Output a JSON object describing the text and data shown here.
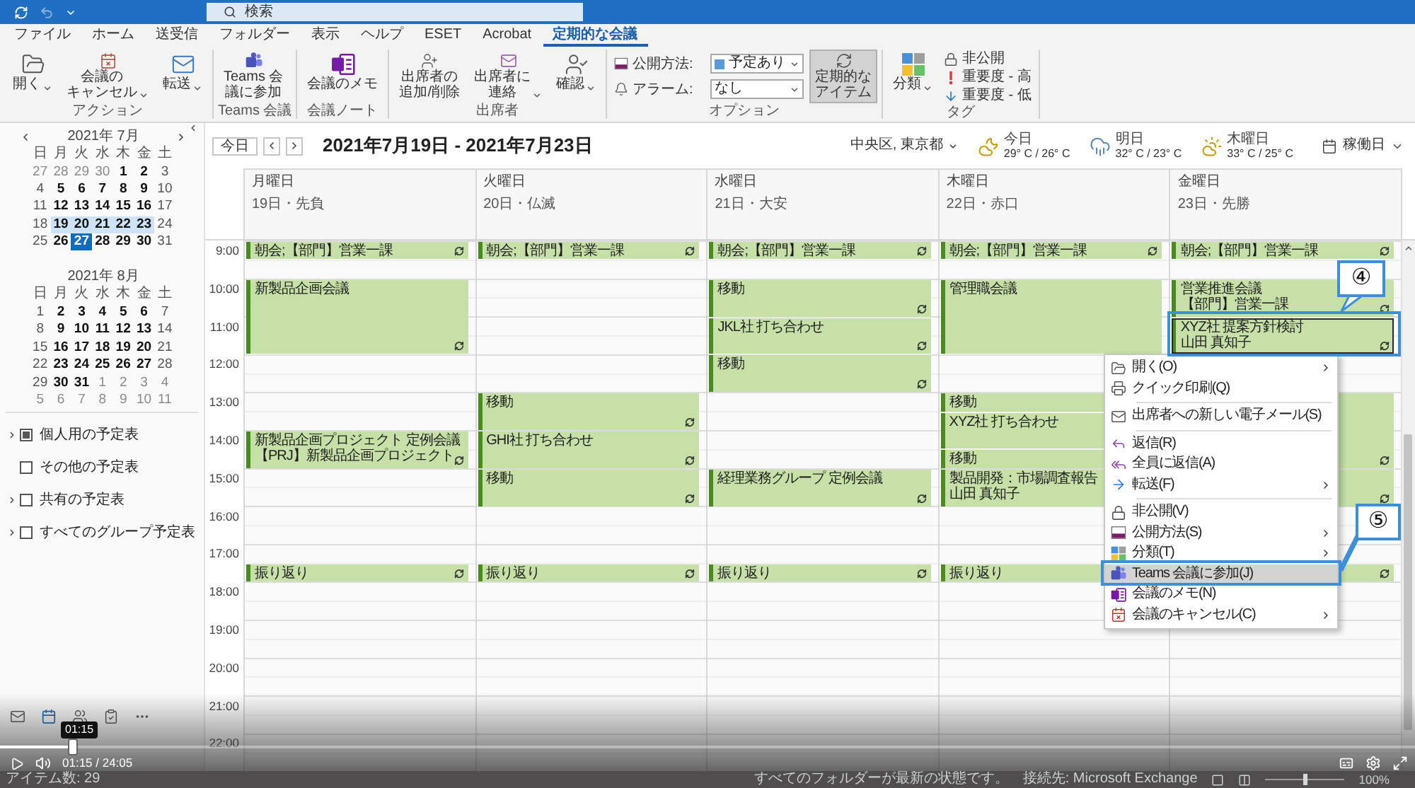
{
  "title_bar": {
    "search": {
      "placeholder": "検索"
    }
  },
  "menu_tabs": [
    {
      "label": "ファイル",
      "selected": false
    },
    {
      "label": "ホーム",
      "selected": false
    },
    {
      "label": "送受信",
      "selected": false
    },
    {
      "label": "フォルダー",
      "selected": false
    },
    {
      "label": "表示",
      "selected": false
    },
    {
      "label": "ヘルプ",
      "selected": false
    },
    {
      "label": "ESET",
      "selected": false
    },
    {
      "label": "Acrobat",
      "selected": false
    },
    {
      "label": "定期的な会議",
      "selected": true
    }
  ],
  "ribbon": [
    {
      "label": "アクション",
      "items": [
        {
          "kind": "large",
          "lines": [
            "開く"
          ],
          "menu": true,
          "pressed": false
        },
        {
          "kind": "large",
          "lines": [
            "会議の",
            "キャンセル"
          ],
          "menu": true,
          "pressed": false
        },
        {
          "kind": "large",
          "lines": [
            "転送"
          ],
          "menu": true,
          "pressed": false
        }
      ]
    },
    {
      "label": "Teams 会議",
      "items": [
        {
          "kind": "large",
          "lines": [
            "Teams 会",
            "議に参加"
          ],
          "menu": false,
          "pressed": false
        }
      ]
    },
    {
      "label": "会議ノート",
      "items": [
        {
          "kind": "large",
          "lines": [
            "会議のメモ"
          ],
          "menu": false,
          "pressed": false
        }
      ]
    },
    {
      "label": "出席者",
      "items": [
        {
          "kind": "large",
          "lines": [
            "出席者の",
            "追加/削除"
          ],
          "menu": false,
          "pressed": false
        },
        {
          "kind": "large",
          "lines": [
            "出席者に",
            "連絡"
          ],
          "menu": true,
          "pressed": false
        },
        {
          "kind": "large",
          "lines": [
            "確認"
          ],
          "menu": true,
          "pressed": false
        }
      ]
    },
    {
      "label": "オプション",
      "items": [
        {
          "kind": "field",
          "label": "公開方法:",
          "value": "予定あり",
          "color": "#5b9bd5"
        },
        {
          "kind": "field",
          "label": "アラーム:",
          "value": "なし"
        },
        {
          "kind": "large",
          "lines": [
            "定期的な",
            "アイテム"
          ],
          "menu": false,
          "pressed": true
        }
      ]
    },
    {
      "label": "タグ",
      "items": [
        {
          "kind": "large",
          "lines": [
            "分類"
          ],
          "menu": true,
          "pressed": false
        },
        {
          "kind": "small",
          "label": "非公開"
        },
        {
          "kind": "small",
          "label": "重要度 - 高"
        },
        {
          "kind": "small",
          "label": "重要度 - 低"
        }
      ]
    }
  ],
  "sidebar": {
    "mini_calendars": [
      {
        "title": "2021年 7月",
        "nav": true,
        "weekdays": [
          "日",
          "月",
          "火",
          "水",
          "木",
          "金",
          "土"
        ],
        "weeks": [
          [
            {
              "day": "27",
              "other": true,
              "bold": false,
              "selected": false,
              "today": false
            },
            {
              "day": "28",
              "other": true,
              "bold": false,
              "selected": false,
              "today": false
            },
            {
              "day": "29",
              "other": true,
              "bold": false,
              "selected": false,
              "today": false
            },
            {
              "day": "30",
              "other": true,
              "bold": false,
              "selected": false,
              "today": false
            },
            {
              "day": "1",
              "other": false,
              "bold": true,
              "selected": false,
              "today": false
            },
            {
              "day": "2",
              "other": false,
              "bold": true,
              "selected": false,
              "today": false
            },
            {
              "day": "3",
              "other": false,
              "bold": false,
              "selected": false,
              "today": false
            }
          ],
          [
            {
              "day": "4",
              "other": false,
              "bold": false,
              "selected": false,
              "today": false
            },
            {
              "day": "5",
              "other": false,
              "bold": true,
              "selected": false,
              "today": false
            },
            {
              "day": "6",
              "other": false,
              "bold": true,
              "selected": false,
              "today": false
            },
            {
              "day": "7",
              "other": false,
              "bold": true,
              "selected": false,
              "today": false
            },
            {
              "day": "8",
              "other": false,
              "bold": true,
              "selected": false,
              "today": false
            },
            {
              "day": "9",
              "other": false,
              "bold": true,
              "selected": false,
              "today": false
            },
            {
              "day": "10",
              "other": false,
              "bold": false,
              "selected": false,
              "today": false
            }
          ],
          [
            {
              "day": "11",
              "other": false,
              "bold": false,
              "selected": false,
              "today": false
            },
            {
              "day": "12",
              "other": false,
              "bold": true,
              "selected": false,
              "today": false
            },
            {
              "day": "13",
              "other": false,
              "bold": true,
              "selected": false,
              "today": false
            },
            {
              "day": "14",
              "other": false,
              "bold": true,
              "selected": false,
              "today": false
            },
            {
              "day": "15",
              "other": false,
              "bold": true,
              "selected": false,
              "today": false
            },
            {
              "day": "16",
              "other": false,
              "bold": true,
              "selected": false,
              "today": false
            },
            {
              "day": "17",
              "other": false,
              "bold": false,
              "selected": false,
              "today": false
            }
          ],
          [
            {
              "day": "18",
              "other": false,
              "bold": false,
              "selected": false,
              "today": false
            },
            {
              "day": "19",
              "other": false,
              "bold": true,
              "selected": true,
              "today": false
            },
            {
              "day": "20",
              "other": false,
              "bold": true,
              "selected": true,
              "today": false
            },
            {
              "day": "21",
              "other": false,
              "bold": true,
              "selected": true,
              "today": false
            },
            {
              "day": "22",
              "other": false,
              "bold": true,
              "selected": true,
              "today": false
            },
            {
              "day": "23",
              "other": false,
              "bold": true,
              "selected": true,
              "today": false
            },
            {
              "day": "24",
              "other": false,
              "bold": false,
              "selected": false,
              "today": false
            }
          ],
          [
            {
              "day": "25",
              "other": false,
              "bold": false,
              "selected": false,
              "today": false
            },
            {
              "day": "26",
              "other": false,
              "bold": true,
              "selected": false,
              "today": false
            },
            {
              "day": "27",
              "other": false,
              "bold": true,
              "selected": false,
              "today": true
            },
            {
              "day": "28",
              "other": false,
              "bold": true,
              "selected": false,
              "today": false
            },
            {
              "day": "29",
              "other": false,
              "bold": true,
              "selected": false,
              "today": false
            },
            {
              "day": "30",
              "other": false,
              "bold": true,
              "selected": false,
              "today": false
            },
            {
              "day": "31",
              "other": false,
              "bold": false,
              "selected": false,
              "today": false
            }
          ]
        ]
      },
      {
        "title": "2021年 8月",
        "nav": false,
        "weekdays": [
          "日",
          "月",
          "火",
          "水",
          "木",
          "金",
          "土"
        ],
        "weeks": [
          [
            {
              "day": "1",
              "other": false,
              "bold": false,
              "selected": false,
              "today": false
            },
            {
              "day": "2",
              "other": false,
              "bold": true,
              "selected": false,
              "today": false
            },
            {
              "day": "3",
              "other": false,
              "bold": true,
              "selected": false,
              "today": false
            },
            {
              "day": "4",
              "other": false,
              "bold": true,
              "selected": false,
              "today": false
            },
            {
              "day": "5",
              "other": false,
              "bold": true,
              "selected": false,
              "today": false
            },
            {
              "day": "6",
              "other": false,
              "bold": true,
              "selected": false,
              "today": false
            },
            {
              "day": "7",
              "other": false,
              "bold": false,
              "selected": false,
              "today": false
            }
          ],
          [
            {
              "day": "8",
              "other": false,
              "bold": false,
              "selected": false,
              "today": false
            },
            {
              "day": "9",
              "other": false,
              "bold": true,
              "selected": false,
              "today": false
            },
            {
              "day": "10",
              "other": false,
              "bold": true,
              "selected": false,
              "today": false
            },
            {
              "day": "11",
              "other": false,
              "bold": true,
              "selected": false,
              "today": false
            },
            {
              "day": "12",
              "other": false,
              "bold": true,
              "selected": false,
              "today": false
            },
            {
              "day": "13",
              "other": false,
              "bold": true,
              "selected": false,
              "today": false
            },
            {
              "day": "14",
              "other": false,
              "bold": false,
              "selected": false,
              "today": false
            }
          ],
          [
            {
              "day": "15",
              "other": false,
              "bold": false,
              "selected": false,
              "today": false
            },
            {
              "day": "16",
              "other": false,
              "bold": true,
              "selected": false,
              "today": false
            },
            {
              "day": "17",
              "other": false,
              "bold": true,
              "selected": false,
              "today": false
            },
            {
              "day": "18",
              "other": false,
              "bold": true,
              "selected": false,
              "today": false
            },
            {
              "day": "19",
              "other": false,
              "bold": true,
              "selected": false,
              "today": false
            },
            {
              "day": "20",
              "other": false,
              "bold": true,
              "selected": false,
              "today": false
            },
            {
              "day": "21",
              "other": false,
              "bold": false,
              "selected": false,
              "today": false
            }
          ],
          [
            {
              "day": "22",
              "other": false,
              "bold": false,
              "selected": false,
              "today": false
            },
            {
              "day": "23",
              "other": false,
              "bold": true,
              "selected": false,
              "today": false
            },
            {
              "day": "24",
              "other": false,
              "bold": true,
              "selected": false,
              "today": false
            },
            {
              "day": "25",
              "other": false,
              "bold": true,
              "selected": false,
              "today": false
            },
            {
              "day": "26",
              "other": false,
              "bold": true,
              "selected": false,
              "today": false
            },
            {
              "day": "27",
              "other": false,
              "bold": true,
              "selected": false,
              "today": false
            },
            {
              "day": "28",
              "other": false,
              "bold": false,
              "selected": false,
              "today": false
            }
          ],
          [
            {
              "day": "29",
              "other": false,
              "bold": false,
              "selected": false,
              "today": false
            },
            {
              "day": "30",
              "other": false,
              "bold": true,
              "selected": false,
              "today": false
            },
            {
              "day": "31",
              "other": false,
              "bold": true,
              "selected": false,
              "today": false
            },
            {
              "day": "1",
              "other": true,
              "bold": false,
              "selected": false,
              "today": false
            },
            {
              "day": "2",
              "other": true,
              "bold": false,
              "selected": false,
              "today": false
            },
            {
              "day": "3",
              "other": true,
              "bold": false,
              "selected": false,
              "today": false
            },
            {
              "day": "4",
              "other": true,
              "bold": false,
              "selected": false,
              "today": false
            }
          ],
          [
            {
              "day": "5",
              "other": true,
              "bold": false,
              "selected": false,
              "today": false
            },
            {
              "day": "6",
              "other": true,
              "bold": false,
              "selected": false,
              "today": false
            },
            {
              "day": "7",
              "other": true,
              "bold": false,
              "selected": false,
              "today": false
            },
            {
              "day": "8",
              "other": true,
              "bold": false,
              "selected": false,
              "today": false
            },
            {
              "day": "9",
              "other": true,
              "bold": false,
              "selected": false,
              "today": false
            },
            {
              "day": "10",
              "other": true,
              "bold": false,
              "selected": false,
              "today": false
            },
            {
              "day": "11",
              "other": true,
              "bold": false,
              "selected": false,
              "today": false
            }
          ]
        ]
      }
    ],
    "calendar_groups": [
      {
        "label": "個人用の予定表",
        "expandable": true,
        "checked": true
      },
      {
        "label": "その他の予定表",
        "expandable": false,
        "checked": false
      },
      {
        "label": "共有の予定表",
        "expandable": true,
        "checked": false
      },
      {
        "label": "すべてのグループ予定表",
        "expandable": true,
        "checked": false
      }
    ]
  },
  "nav_bar": [
    {
      "selected": false
    },
    {
      "selected": true
    },
    {
      "selected": false
    },
    {
      "selected": false
    }
  ],
  "toolbar": {
    "today_button": "今日",
    "date_range": "2021年7月19日 - 2021年7月23日",
    "location": "中央区, 東京都",
    "weather": [
      {
        "day": "今日",
        "temperature": "29° C / 26° C"
      },
      {
        "day": "明日",
        "temperature": "32° C / 23° C"
      },
      {
        "day": "木曜日",
        "temperature": "33° C / 25° C"
      }
    ],
    "view": "稼働日"
  },
  "time_labels": [
    "9:00",
    "10:00",
    "11:00",
    "12:00",
    "13:00",
    "14:00",
    "15:00",
    "16:00",
    "17:00",
    "18:00",
    "19:00",
    "20:00",
    "21:00",
    "22:00"
  ],
  "days": [
    {
      "weekday": "月曜日",
      "date": "19日・先負",
      "half_hour_slots": [
        {
          "kind": "event",
          "lines": [
            "朝会;【部門】営業一課"
          ],
          "recurring": true,
          "selected": false
        },
        {
          "kind": "free"
        },
        {
          "kind": "event",
          "lines": [
            "新製品企画会議"
          ],
          "recurring": true,
          "selected": false
        },
        {
          "kind": "continued"
        },
        {
          "kind": "continued"
        },
        {
          "kind": "continued"
        },
        {
          "kind": "free"
        },
        {
          "kind": "free"
        },
        {
          "kind": "free"
        },
        {
          "kind": "free"
        },
        {
          "kind": "event",
          "lines": [
            "新製品企画プロジェクト 定例会議",
            "【PRJ】新製品企画プロジェクト"
          ],
          "recurring": true,
          "selected": false
        },
        {
          "kind": "continued"
        },
        {
          "kind": "free"
        },
        {
          "kind": "free"
        },
        {
          "kind": "free"
        },
        {
          "kind": "free"
        },
        {
          "kind": "free"
        },
        {
          "kind": "event",
          "lines": [
            "振り返り"
          ],
          "recurring": true,
          "selected": false
        }
      ]
    },
    {
      "weekday": "火曜日",
      "date": "20日・仏滅",
      "half_hour_slots": [
        {
          "kind": "event",
          "lines": [
            "朝会;【部門】営業一課"
          ],
          "recurring": true,
          "selected": false
        },
        {
          "kind": "free"
        },
        {
          "kind": "free"
        },
        {
          "kind": "free"
        },
        {
          "kind": "free"
        },
        {
          "kind": "free"
        },
        {
          "kind": "free"
        },
        {
          "kind": "free"
        },
        {
          "kind": "event",
          "lines": [
            "移動"
          ],
          "recurring": true,
          "selected": false
        },
        {
          "kind": "continued"
        },
        {
          "kind": "event",
          "lines": [
            "GHI社 打ち合わせ"
          ],
          "recurring": true,
          "selected": false
        },
        {
          "kind": "continued"
        },
        {
          "kind": "event",
          "lines": [
            "移動"
          ],
          "recurring": true,
          "selected": false
        },
        {
          "kind": "continued"
        },
        {
          "kind": "free"
        },
        {
          "kind": "free"
        },
        {
          "kind": "free"
        },
        {
          "kind": "event",
          "lines": [
            "振り返り"
          ],
          "recurring": true,
          "selected": false
        }
      ]
    },
    {
      "weekday": "水曜日",
      "date": "21日・大安",
      "half_hour_slots": [
        {
          "kind": "event",
          "lines": [
            "朝会;【部門】営業一課"
          ],
          "recurring": true,
          "selected": false
        },
        {
          "kind": "free"
        },
        {
          "kind": "event",
          "lines": [
            "移動"
          ],
          "recurring": true,
          "selected": false
        },
        {
          "kind": "continued"
        },
        {
          "kind": "event",
          "lines": [
            "JKL社 打ち合わせ"
          ],
          "recurring": true,
          "selected": false
        },
        {
          "kind": "continued"
        },
        {
          "kind": "event",
          "lines": [
            "移動"
          ],
          "recurring": true,
          "selected": false
        },
        {
          "kind": "continued"
        },
        {
          "kind": "free"
        },
        {
          "kind": "free"
        },
        {
          "kind": "free"
        },
        {
          "kind": "free"
        },
        {
          "kind": "event",
          "lines": [
            "経理業務グループ 定例会議"
          ],
          "recurring": true,
          "selected": false
        },
        {
          "kind": "continued"
        },
        {
          "kind": "free"
        },
        {
          "kind": "free"
        },
        {
          "kind": "free"
        },
        {
          "kind": "event",
          "lines": [
            "振り返り"
          ],
          "recurring": true,
          "selected": false
        }
      ]
    },
    {
      "weekday": "木曜日",
      "date": "22日・赤口",
      "half_hour_slots": [
        {
          "kind": "event",
          "lines": [
            "朝会;【部門】営業一課"
          ],
          "recurring": true,
          "selected": false
        },
        {
          "kind": "free"
        },
        {
          "kind": "event",
          "lines": [
            "管理職会議"
          ],
          "recurring": false,
          "selected": false
        },
        {
          "kind": "continued"
        },
        {
          "kind": "continued"
        },
        {
          "kind": "continued"
        },
        {
          "kind": "free"
        },
        {
          "kind": "free"
        },
        {
          "kind": "event",
          "lines": [
            "移動"
          ],
          "selected": false
        },
        {
          "kind": "event",
          "lines": [
            "XYZ社 打ち合わせ"
          ],
          "selected": false
        },
        {
          "kind": "continued"
        },
        {
          "kind": "event",
          "lines": [
            "移動"
          ],
          "selected": false
        },
        {
          "kind": "event",
          "lines": [
            "製品開発：市場調査報告",
            "山田 真知子"
          ],
          "selected": false
        },
        {
          "kind": "continued"
        },
        {
          "kind": "free"
        },
        {
          "kind": "free"
        },
        {
          "kind": "free"
        },
        {
          "kind": "event",
          "lines": [
            "振り返り"
          ],
          "selected": false
        }
      ]
    },
    {
      "weekday": "金曜日",
      "date": "23日・先勝",
      "half_hour_slots": [
        {
          "kind": "event",
          "lines": [
            "朝会;【部門】営業一課"
          ],
          "recurring": true,
          "selected": false
        },
        {
          "kind": "free"
        },
        {
          "kind": "event",
          "lines": [
            "営業推進会議",
            "【部門】営業一課"
          ],
          "recurring": true,
          "selected": false
        },
        {
          "kind": "continued"
        },
        {
          "kind": "event",
          "lines": [
            "XYZ社 提案方針検討",
            "山田 真知子"
          ],
          "recurring": true,
          "selected": true
        },
        {
          "kind": "continued"
        },
        {
          "kind": "free"
        },
        {
          "kind": "free"
        },
        {
          "kind": "event",
          "recurring": true,
          "selected": false
        },
        {
          "kind": "continued"
        },
        {
          "kind": "continued"
        },
        {
          "kind": "continued"
        },
        {
          "kind": "event",
          "recurring": true,
          "selected": false
        },
        {
          "kind": "continued"
        },
        {
          "kind": "free"
        },
        {
          "kind": "free"
        },
        {
          "kind": "free"
        },
        {
          "kind": "event",
          "recurring": true,
          "selected": false
        }
      ]
    }
  ],
  "context_menu": [
    {
      "label": "開く(O)",
      "submenu": true,
      "separator_before": false,
      "selected": false
    },
    {
      "label": "クイック印刷(Q)",
      "submenu": false,
      "separator_before": false,
      "selected": false
    },
    {
      "label": "出席者への新しい電子メール(S)",
      "submenu": false,
      "separator_before": true,
      "selected": false
    },
    {
      "label": "返信(R)",
      "submenu": false,
      "separator_before": true,
      "selected": false
    },
    {
      "label": "全員に返信(A)",
      "submenu": false,
      "separator_before": false,
      "selected": false
    },
    {
      "label": "転送(F)",
      "submenu": true,
      "separator_before": false,
      "selected": false
    },
    {
      "label": "非公開(V)",
      "submenu": false,
      "separator_before": true,
      "selected": false
    },
    {
      "label": "公開方法(S)",
      "submenu": true,
      "separator_before": false,
      "selected": false
    },
    {
      "label": "分類(T)",
      "submenu": true,
      "separator_before": false,
      "selected": false
    },
    {
      "label": "Teams 会議に参加(J)",
      "submenu": false,
      "separator_before": false,
      "selected": true
    },
    {
      "label": "会議のメモ(N)",
      "submenu": false,
      "separator_before": false,
      "selected": false
    },
    {
      "label": "会議のキャンセル(C)",
      "submenu": true,
      "separator_before": false,
      "selected": false
    }
  ],
  "callouts": [
    {
      "label": "④"
    },
    {
      "label": "⑤"
    }
  ],
  "video_player": {
    "tooltip": "01:15",
    "time": "01:15 / 24:05",
    "level": 0.052
  },
  "status_bar": {
    "items": "アイテム数: 29",
    "sync": "すべてのフォルダーが最新の状態です。",
    "connection": "接続先: Microsoft Exchange",
    "zoom_slider": {
      "level": 0.5
    },
    "zoom": "100%"
  }
}
